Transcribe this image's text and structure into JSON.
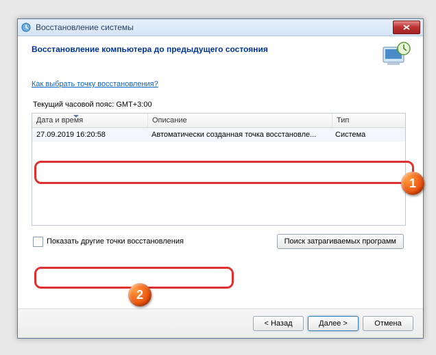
{
  "title": "Восстановление системы",
  "heading": "Восстановление компьютера до предыдущего состояния",
  "help_link": "Как выбрать точку восстановления?",
  "timezone": "Текущий часовой пояс: GMT+3:00",
  "columns": {
    "date": "Дата и время",
    "desc": "Описание",
    "type": "Тип"
  },
  "row": {
    "date": "27.09.2019 16:20:58",
    "desc": "Автоматически созданная точка восстановле...",
    "type": "Система"
  },
  "show_more": "Показать другие точки восстановления",
  "scan_btn": "Поиск затрагиваемых программ",
  "back": "< Назад",
  "next": "Далее >",
  "cancel": "Отмена",
  "markers": {
    "m1": "1",
    "m2": "2"
  }
}
